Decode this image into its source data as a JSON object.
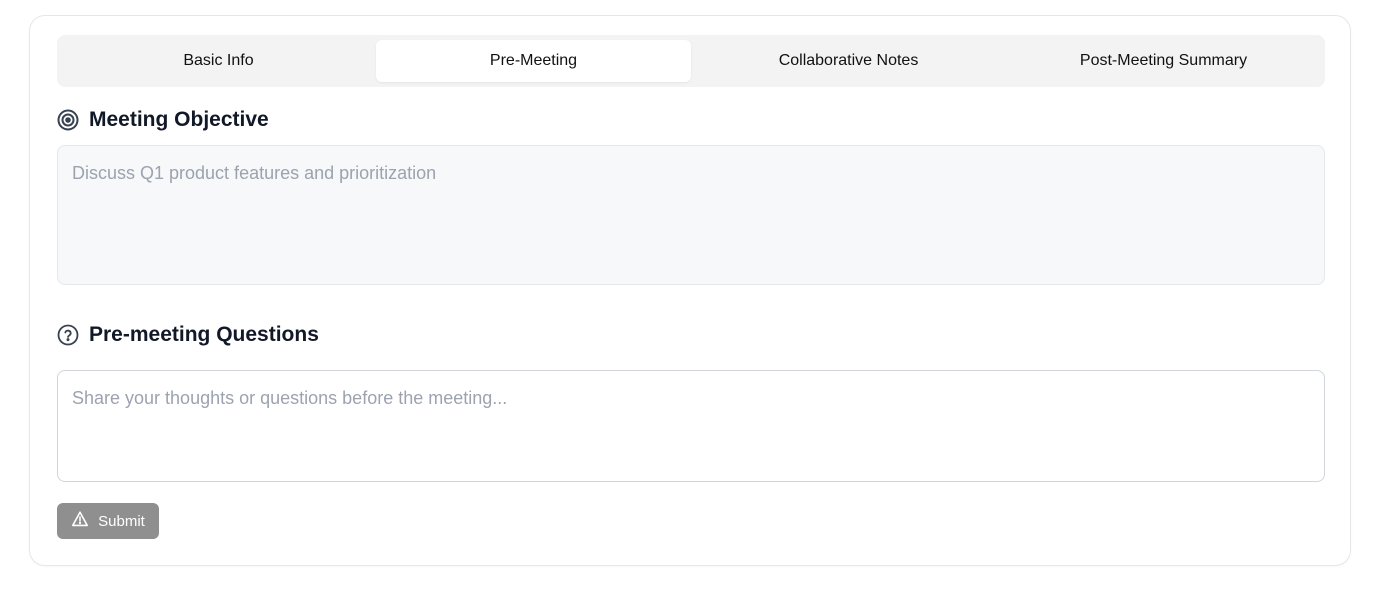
{
  "tabs": [
    {
      "label": "Basic Info",
      "active": false
    },
    {
      "label": "Pre-Meeting",
      "active": true
    },
    {
      "label": "Collaborative Notes",
      "active": false
    },
    {
      "label": "Post-Meeting Summary",
      "active": false
    }
  ],
  "objective": {
    "title": "Meeting Objective",
    "icon": "target-icon",
    "text": "Discuss Q1 product features and prioritization"
  },
  "questions": {
    "title": "Pre-meeting Questions",
    "icon": "help-circle-icon",
    "placeholder": "Share your thoughts or questions before the meeting...",
    "value": ""
  },
  "submit": {
    "label": "Submit",
    "icon": "warning-triangle-icon"
  },
  "colors": {
    "tab_bar_bg": "#f3f3f3",
    "objective_bg": "#f7f8f9",
    "placeholder": "#9ca3af",
    "submit_bg": "#8f8f8f"
  }
}
